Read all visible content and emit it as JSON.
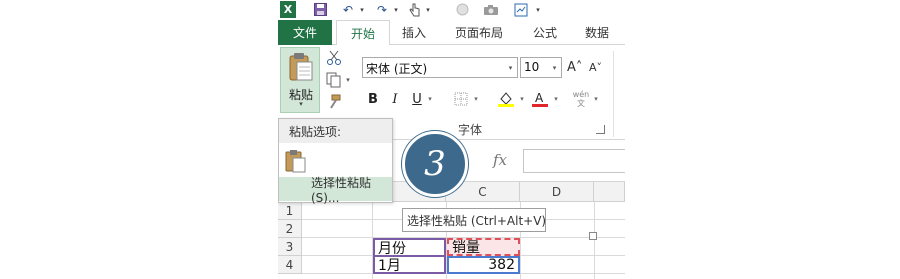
{
  "quick_access": {
    "excel_badge": "X",
    "undo": "↶",
    "redo": "↷",
    "more": "▾"
  },
  "tabs": [
    {
      "label": "文件"
    },
    {
      "label": "开始"
    },
    {
      "label": "插入"
    },
    {
      "label": "页面布局"
    },
    {
      "label": "公式"
    },
    {
      "label": "数据"
    }
  ],
  "clipboard": {
    "paste_label": "粘贴",
    "paste_caret": "▾"
  },
  "font": {
    "name": "宋体 (正文)",
    "size": "10",
    "grow": "A˄",
    "shrink": "A˅",
    "bold": "B",
    "italic": "I",
    "underline": "U",
    "wen": "wén",
    "group_label": "字体"
  },
  "paste_menu": {
    "header": "粘贴选项:",
    "item": "选择性粘贴(S)..."
  },
  "tooltip": "选择性粘贴 (Ctrl+Alt+V)",
  "step_badge": "3",
  "formula": {
    "fx": "fx"
  },
  "grid": {
    "columns": [
      "C",
      "D"
    ],
    "rows": [
      "1",
      "2",
      "3",
      "4"
    ],
    "cells": {
      "b3": "月份",
      "c3": "销量",
      "b4": "1月",
      "c4": "382"
    }
  },
  "colors": {
    "excel_green": "#217346",
    "badge_blue": "#3d6a8c",
    "hover_green": "#d3e7d8"
  }
}
